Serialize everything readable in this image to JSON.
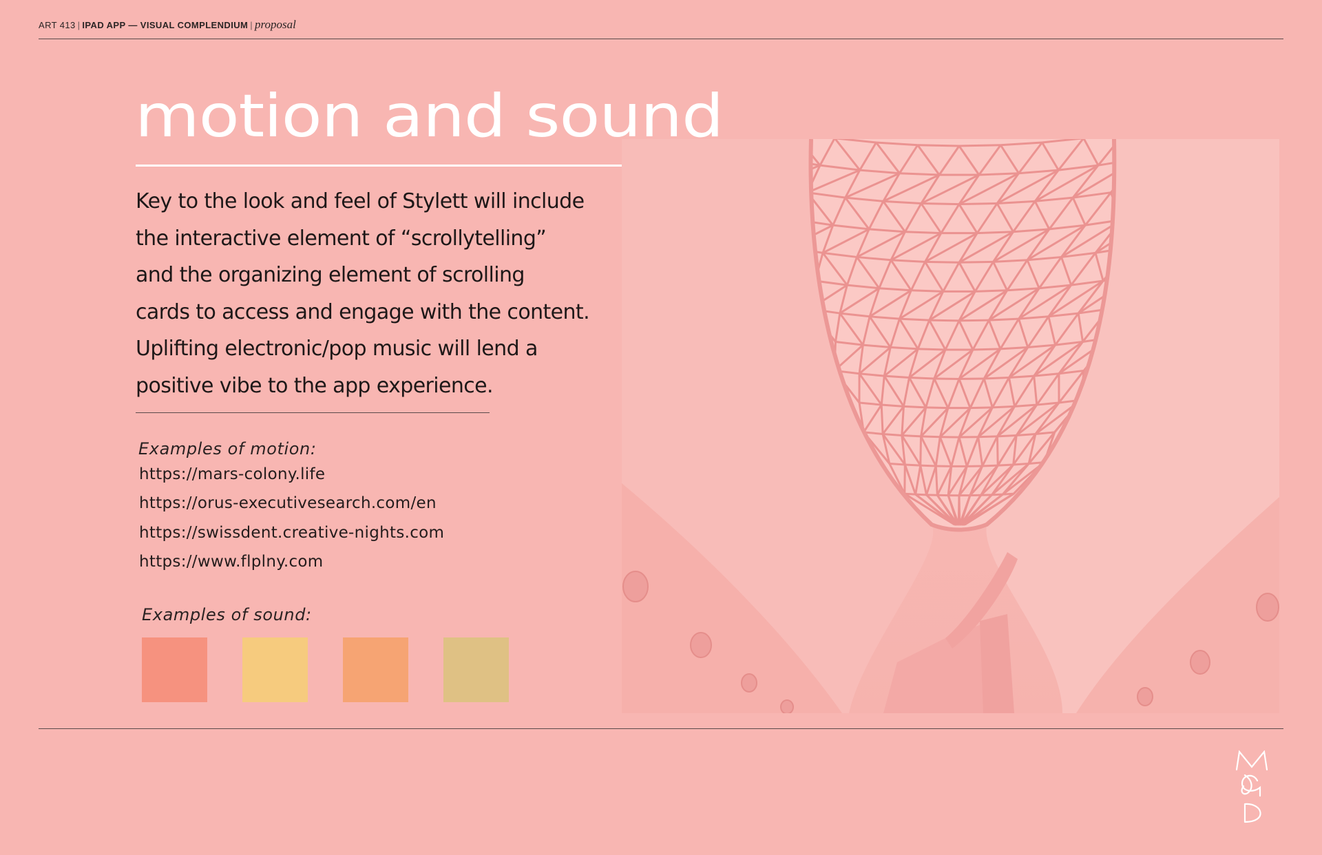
{
  "header": {
    "course": "ART 413",
    "project": "IPAD APP — VISUAL COMPLENDIUM",
    "stage": "proposal"
  },
  "title": "motion and sound",
  "body": {
    "lines": [
      "Key to the look and feel of Stylett will include",
      "the interactive element of “scrollytelling”",
      "and the organizing element of scrolling",
      "cards to access and engage with the content.",
      "Uplifting electronic/pop music will lend a",
      "positive vibe to the app experience."
    ]
  },
  "motion": {
    "heading": "Examples of motion:",
    "links": [
      "https://mars-colony.life",
      "https://orus-executivesearch.com/en",
      "https://swissdent.creative-nights.com",
      "https://www.flplny.com"
    ]
  },
  "sound": {
    "heading": "Examples of sound:",
    "swatches": [
      "#f6927f",
      "#f6cb7e",
      "#f6a473",
      "#dfc184"
    ]
  },
  "colors": {
    "background": "#f8b6b2",
    "title": "#ffffff",
    "text": "#1e1818",
    "rule": "#5a4b4b"
  },
  "image": {
    "subject": "pink-tinted photo looking up at a geodesic glass dome ceiling with a spiral staircase"
  }
}
